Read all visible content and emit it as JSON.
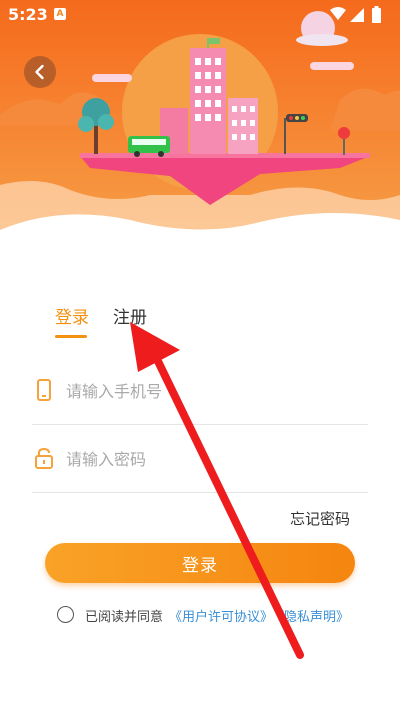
{
  "status_bar": {
    "time": "5:23",
    "notif_glyph": "A"
  },
  "tabs": {
    "login": "登录",
    "register": "注册"
  },
  "form": {
    "phone_placeholder": "请输入手机号",
    "password_placeholder": "请输入密码",
    "forgot": "忘记密码",
    "submit": "登录"
  },
  "agreement": {
    "text": "已阅读并同意",
    "user_agreement": "《用户许可协议》",
    "privacy": "《隐私声明》"
  },
  "icons": [
    "back-icon",
    "wifi-icon",
    "signal-icon",
    "battery-icon",
    "phone-icon",
    "lock-icon"
  ],
  "colors": {
    "accent": "#f39212",
    "link": "#3a8fd6",
    "hero_orange": "#f4701c",
    "annotation_arrow": "#ee1c1c"
  }
}
